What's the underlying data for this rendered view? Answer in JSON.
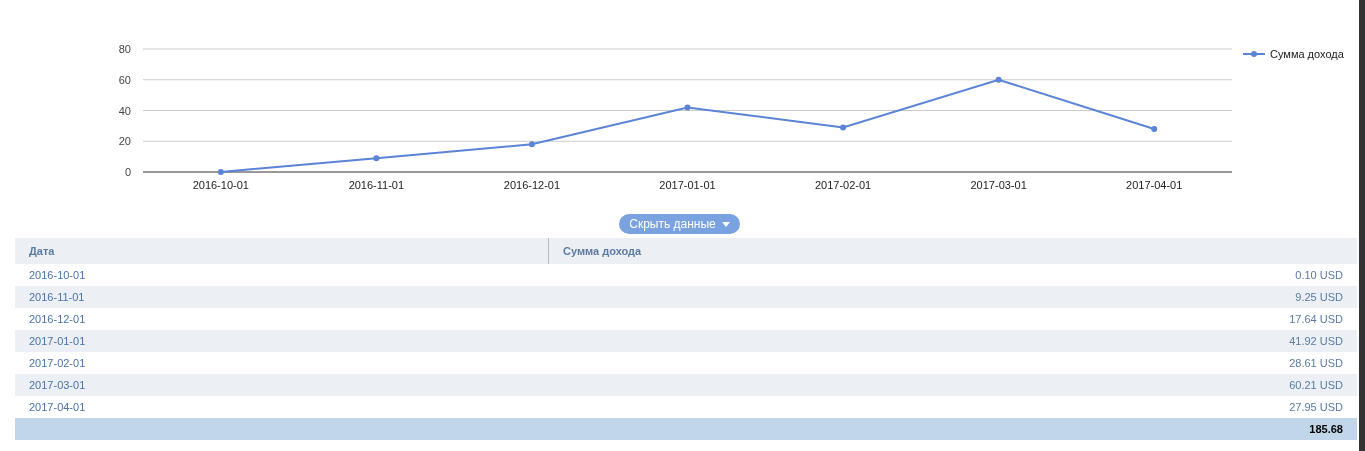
{
  "chart": {
    "chart_data": {
      "type": "line",
      "categories": [
        "2016-10-01",
        "2016-11-01",
        "2016-12-01",
        "2017-01-01",
        "2017-02-01",
        "2017-03-01",
        "2017-04-01"
      ],
      "series": [
        {
          "name": "Сумма дохода",
          "color": "#5b83d6",
          "marker": true,
          "values": [
            0,
            9,
            18,
            42,
            29,
            60,
            28
          ]
        }
      ],
      "ylim": [
        0,
        80
      ],
      "yticks": [
        0,
        20,
        40,
        60,
        80
      ],
      "grid": true
    }
  },
  "toggle_button": {
    "label": "Скрыть данные"
  },
  "table": {
    "columns": [
      "Дата",
      "Сумма дохода"
    ],
    "rows": [
      [
        "2016-10-01",
        "0.10 USD"
      ],
      [
        "2016-11-01",
        "9.25 USD"
      ],
      [
        "2016-12-01",
        "17.64 USD"
      ],
      [
        "2017-01-01",
        "41.92 USD"
      ],
      [
        "2017-02-01",
        "28.61 USD"
      ],
      [
        "2017-03-01",
        "60.21 USD"
      ],
      [
        "2017-04-01",
        "27.95 USD"
      ]
    ],
    "total": "185.68"
  }
}
